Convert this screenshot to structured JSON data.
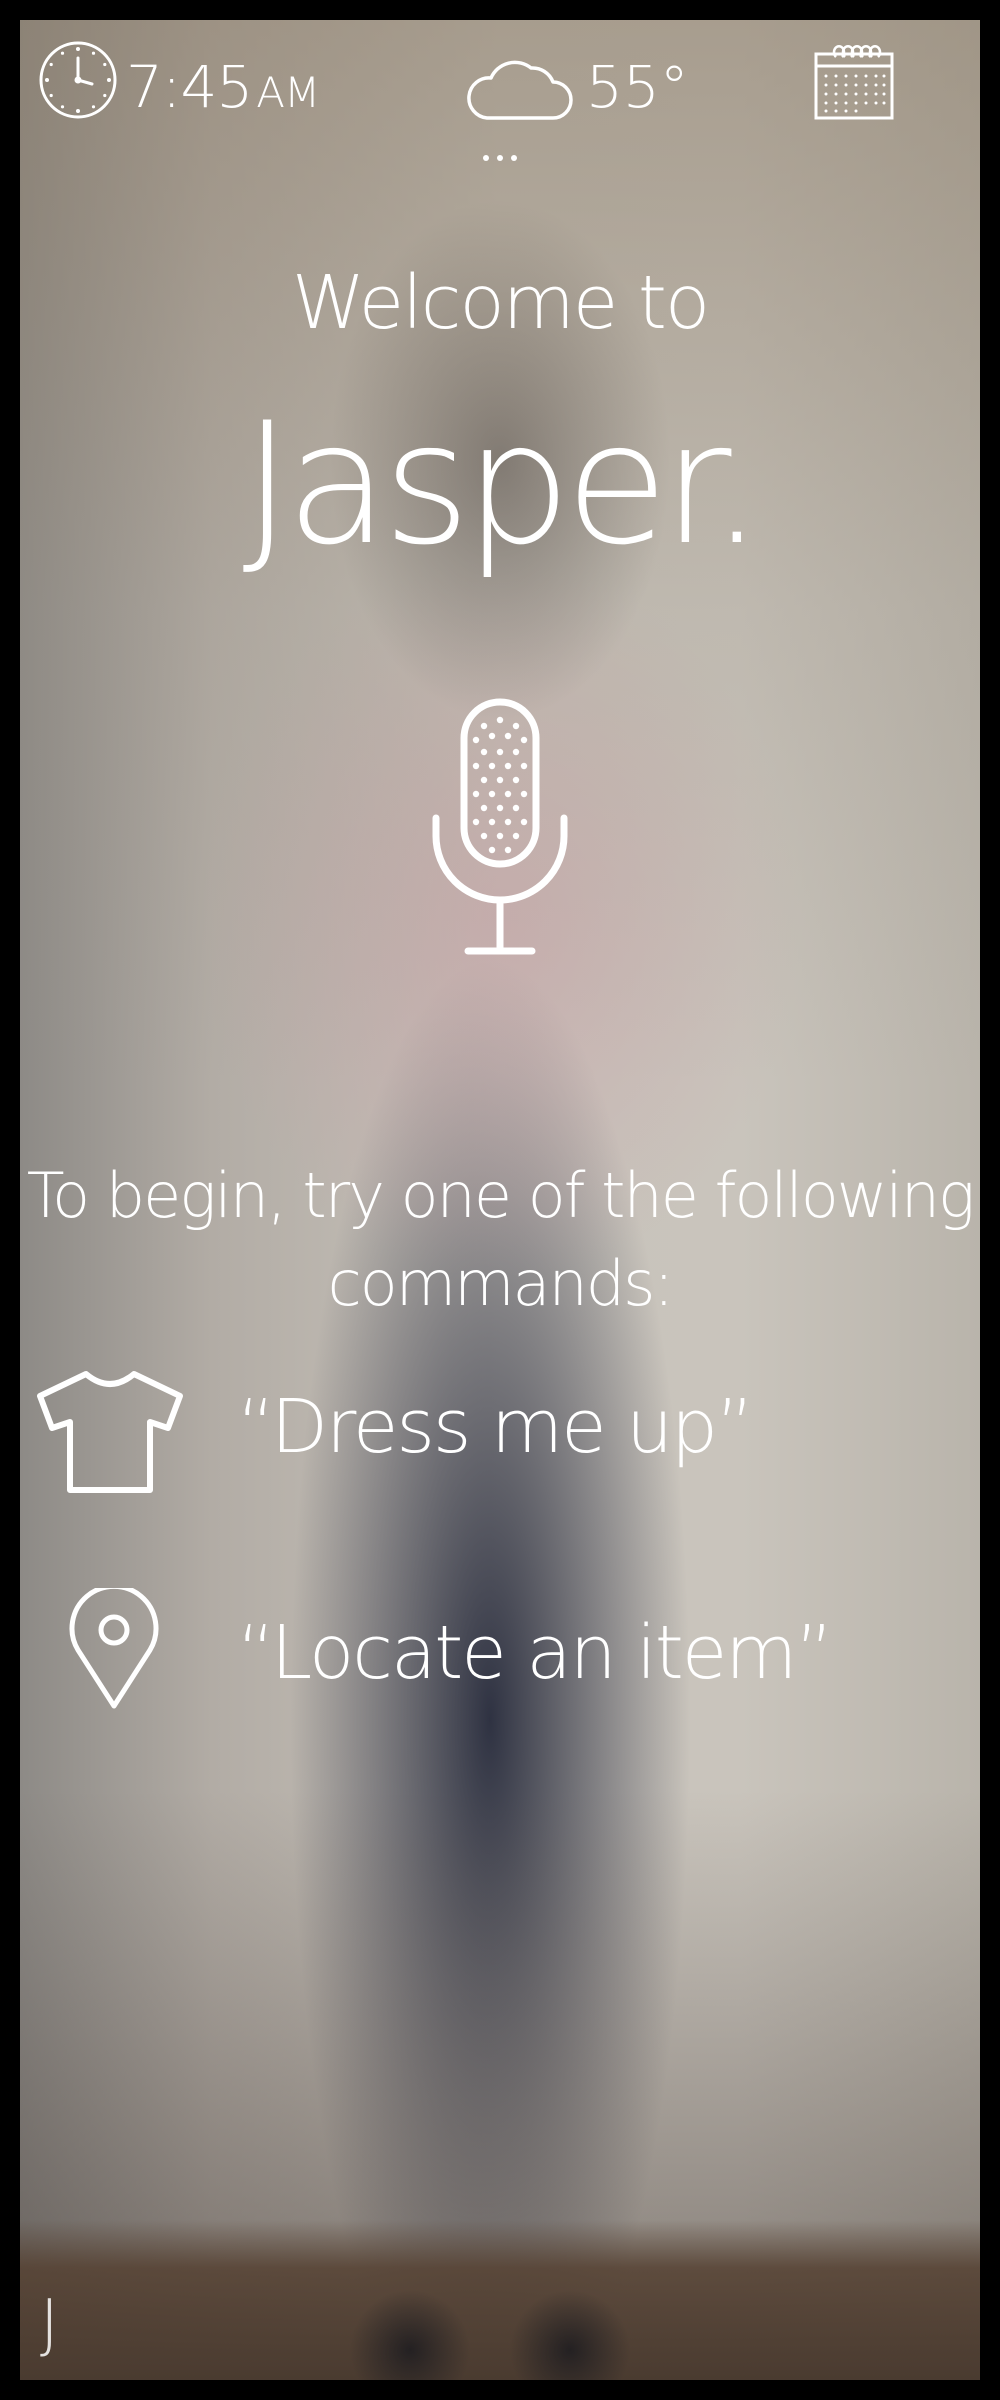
{
  "status_bar": {
    "time": "7:45",
    "ampm": "AM",
    "temperature": "55°",
    "icons": [
      "clock-icon",
      "cloud-icon",
      "calendar-icon",
      "more-icon"
    ]
  },
  "welcome": {
    "greeting": "Welcome to",
    "app_name": "Jasper."
  },
  "mic": {
    "icon": "microphone-icon"
  },
  "prompt": {
    "line1": "To begin, try one of the following",
    "line2": "commands:"
  },
  "commands": [
    {
      "icon": "tshirt-icon",
      "label": "“Dress me up”"
    },
    {
      "icon": "location-pin-icon",
      "label": "“Locate an item”"
    }
  ],
  "footer": {
    "logo": "J"
  },
  "colors": {
    "foreground": "#ffffff",
    "frame": "#000000"
  }
}
